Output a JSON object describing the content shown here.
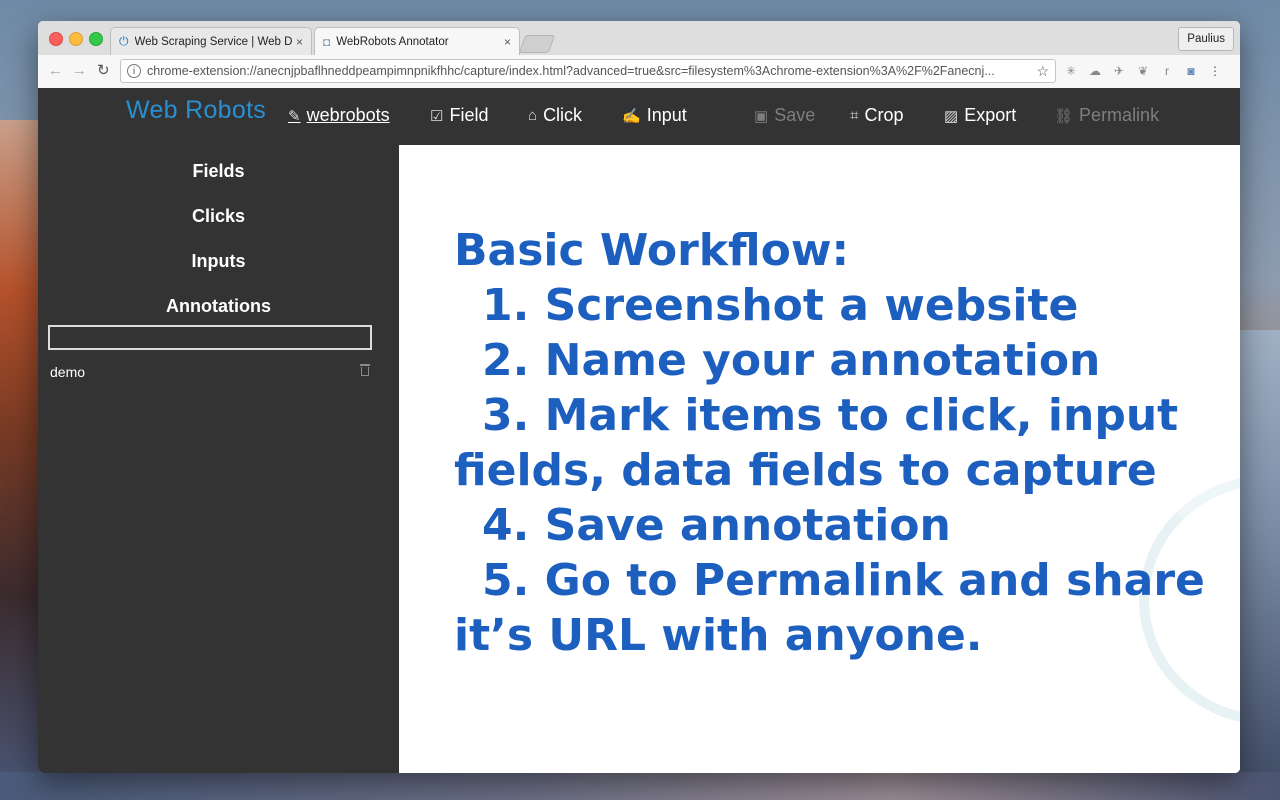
{
  "browser": {
    "tabs": [
      {
        "title": "Web Scraping Service | Web D",
        "icon": "power-icon",
        "active": false
      },
      {
        "title": "WebRobots Annotator",
        "icon": "camera-icon",
        "active": true
      }
    ],
    "tab_close": "×",
    "profile": "Paulius",
    "url": "chrome-extension://anecnjpbaflhneddpeampimnpnikfhhc/capture/index.html?advanced=true&src=filesystem%3Achrome-extension%3A%2F%2Fanecnj..."
  },
  "app": {
    "brand": "Web Robots",
    "user": "webrobots",
    "nav": {
      "field": "Field",
      "click": "Click",
      "input": "Input",
      "save": "Save",
      "crop": "Crop",
      "export": "Export",
      "permalink": "Permalink"
    }
  },
  "sidebar": {
    "fields": "Fields",
    "clicks": "Clicks",
    "inputs": "Inputs",
    "annotations": "Annotations",
    "annotation_input_value": "",
    "annotation_items": [
      "demo"
    ]
  },
  "content": {
    "heading": "Basic Workflow:",
    "steps": [
      "1. Screenshot a website",
      "2. Name your annotation",
      "3. Mark items to click, input",
      "fields, data fields to capture",
      "4. Save annotation",
      "5. Go to Permalink and share",
      "it’s URL with anyone."
    ]
  },
  "colors": {
    "accent_blue": "#1d5fbf",
    "brand_blue": "#2a8fd0",
    "app_dark": "#333333"
  }
}
